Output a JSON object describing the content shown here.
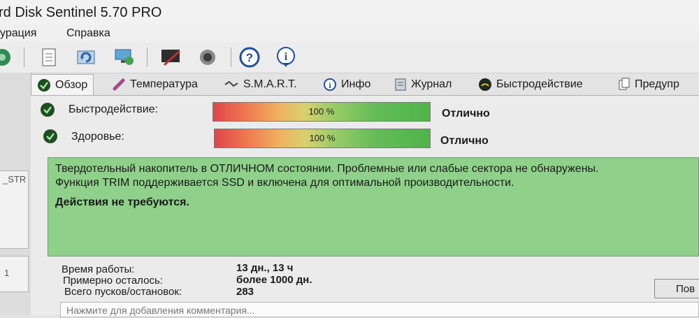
{
  "window": {
    "title": "rd Disk Sentinel 5.70 PRO"
  },
  "menu": {
    "items": [
      "урация",
      "Справка"
    ]
  },
  "toolbar": {
    "icons": [
      "disk-icon",
      "report-icon",
      "refresh-icon",
      "network-icon",
      "edit-icon",
      "speaker-icon",
      "help-icon",
      "info-icon"
    ]
  },
  "left_panel": {
    "item_a": "_STR",
    "item_b": "1"
  },
  "tabs": [
    {
      "label": "Обзор",
      "icon": "check-icon"
    },
    {
      "label": "Температура",
      "icon": "thermometer-icon"
    },
    {
      "label": "S.M.A.R.T.",
      "icon": "smart-icon"
    },
    {
      "label": "Инфо",
      "icon": "info-icon"
    },
    {
      "label": "Журнал",
      "icon": "journal-icon"
    },
    {
      "label": "Быстродействие",
      "icon": "gauge-icon"
    },
    {
      "label": "Предупр",
      "icon": "copy-icon"
    }
  ],
  "performance": {
    "label": "Быстродействие:",
    "value_text": "100 %",
    "value": 100,
    "verdict": "Отлично"
  },
  "health": {
    "label": "Здоровье:",
    "value_text": "100 %",
    "value": 100,
    "verdict": "Отлично"
  },
  "message": {
    "line1": "Твердотельный накопитель в ОТЛИЧНОМ состоянии. Проблемные или слабые сектора не обнаружены.",
    "line2": "Функция TRIM поддерживается SSD и включена для оптимальной производительности.",
    "action": "Действия не требуются."
  },
  "stats": [
    {
      "label": "Время работы:",
      "value": "13 дн., 13 ч"
    },
    {
      "label": "Примерно осталось:",
      "value": "более 1000 дн."
    },
    {
      "label": "Всего пусков/остановок:",
      "value": "283"
    }
  ],
  "button": {
    "label": "Пов"
  },
  "comment": {
    "placeholder": "Нажмите для добавления комментария..."
  },
  "colors": {
    "message_bg": "#8fd18a",
    "bar_good": "#4fb44a",
    "bar_bad": "#e0454a"
  }
}
